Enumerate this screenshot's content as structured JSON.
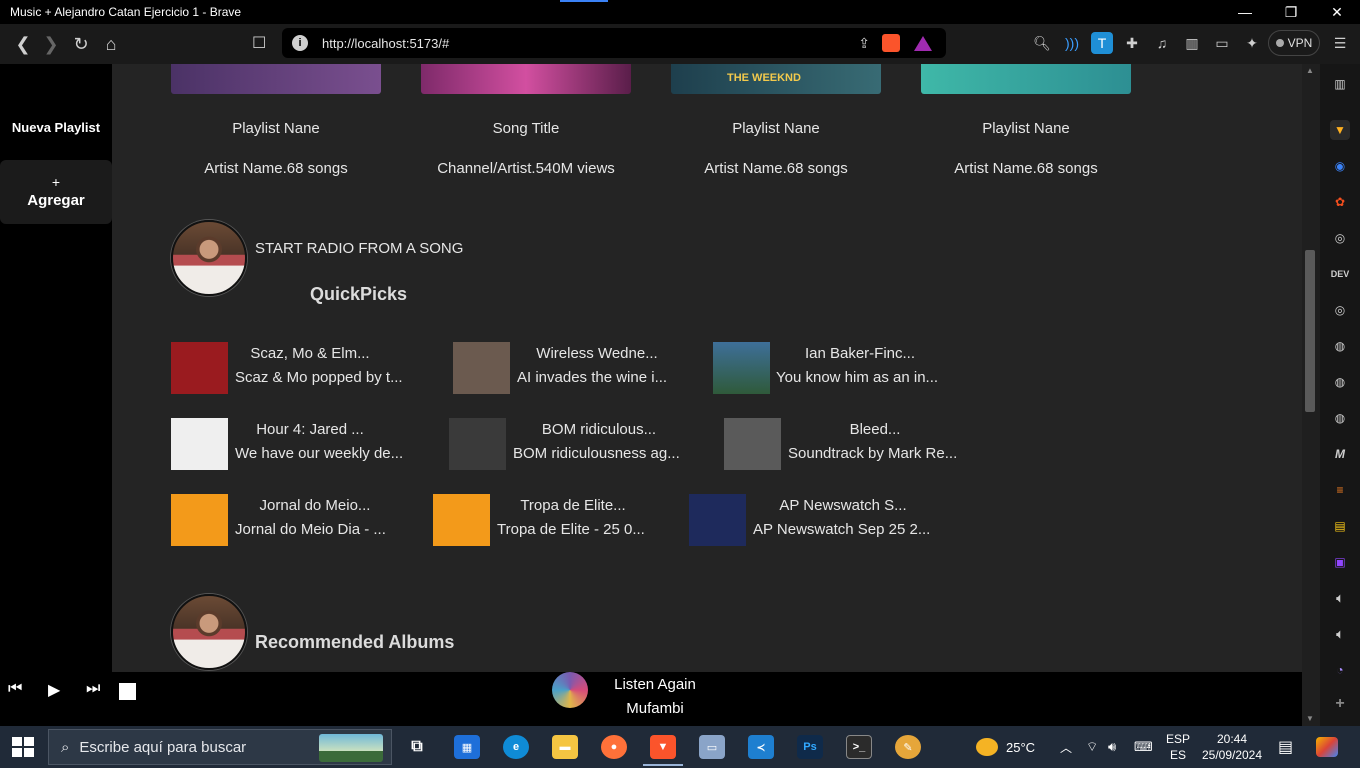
{
  "window": {
    "title": "Music + Alejandro Catan Ejercicio 1 - Brave",
    "minimize": "—",
    "maximize": "❐",
    "close": "✕"
  },
  "toolbar": {
    "url": "http://localhost:5173/#",
    "vpn_label": "VPN"
  },
  "sidebar": {
    "new_playlist": "Nueva Playlist",
    "add_plus": "+",
    "add_label": "Agregar"
  },
  "cards": [
    {
      "title": "Playlist Nane",
      "subtitle": "Artist Name.68 songs",
      "color": "#5b3b77"
    },
    {
      "title": "Song Title",
      "subtitle": "Channel/Artist.540M views",
      "color": "#b23a8a"
    },
    {
      "title": "Playlist Nane",
      "subtitle": "Artist Name.68 songs",
      "color": "#2b5a6b"
    },
    {
      "title": "Playlist Nane",
      "subtitle": "Artist Name.68 songs",
      "color": "#35a7a0"
    }
  ],
  "radio": {
    "label": "START RADIO FROM A SONG",
    "section_title": "QuickPicks"
  },
  "quickpicks": [
    {
      "title": "Scaz, Mo & Elm...",
      "subtitle": "Scaz & Mo popped by t...",
      "thumb": "#9a1b1f"
    },
    {
      "title": "Wireless Wedne...",
      "subtitle": "AI invades the wine i...",
      "thumb": "#6b5a4f"
    },
    {
      "title": "Ian Baker-Finc...",
      "subtitle": "You know him as an in...",
      "thumb": "#3e6f99"
    },
    {
      "title": "Hour 4: Jared ...",
      "subtitle": "We have our weekly de...",
      "thumb": "#efefef"
    },
    {
      "title": "BOM ridiculous...",
      "subtitle": "BOM ridiculousness ag...",
      "thumb": "#3a3a3a"
    },
    {
      "title": "Bleed...",
      "subtitle": "Soundtrack by Mark Re...",
      "thumb": "#5a5a5a"
    },
    {
      "title": "Jornal do Meio...",
      "subtitle": "Jornal do Meio Dia - ...",
      "thumb": "#f39a1a"
    },
    {
      "title": "Tropa de Elite...",
      "subtitle": "Tropa de Elite - 25 0...",
      "thumb": "#f39a1a"
    },
    {
      "title": "AP Newswatch S...",
      "subtitle": "AP Newswatch Sep 25 2...",
      "thumb": "#1e2a5c"
    }
  ],
  "recommended": {
    "title": "Recommended Albums"
  },
  "player": {
    "prev": "⏮",
    "play": "▶",
    "next": "⏭",
    "now_title": "Listen Again",
    "now_artist": "Mufambi"
  },
  "right_sidebar": {
    "dev_label": "DEV",
    "m_label": "M"
  },
  "taskbar": {
    "search_placeholder": "Escribe aquí para buscar",
    "temperature": "25°C",
    "lang_top": "ESP",
    "lang_bottom": "ES",
    "time": "20:44",
    "date": "25/09/2024"
  }
}
